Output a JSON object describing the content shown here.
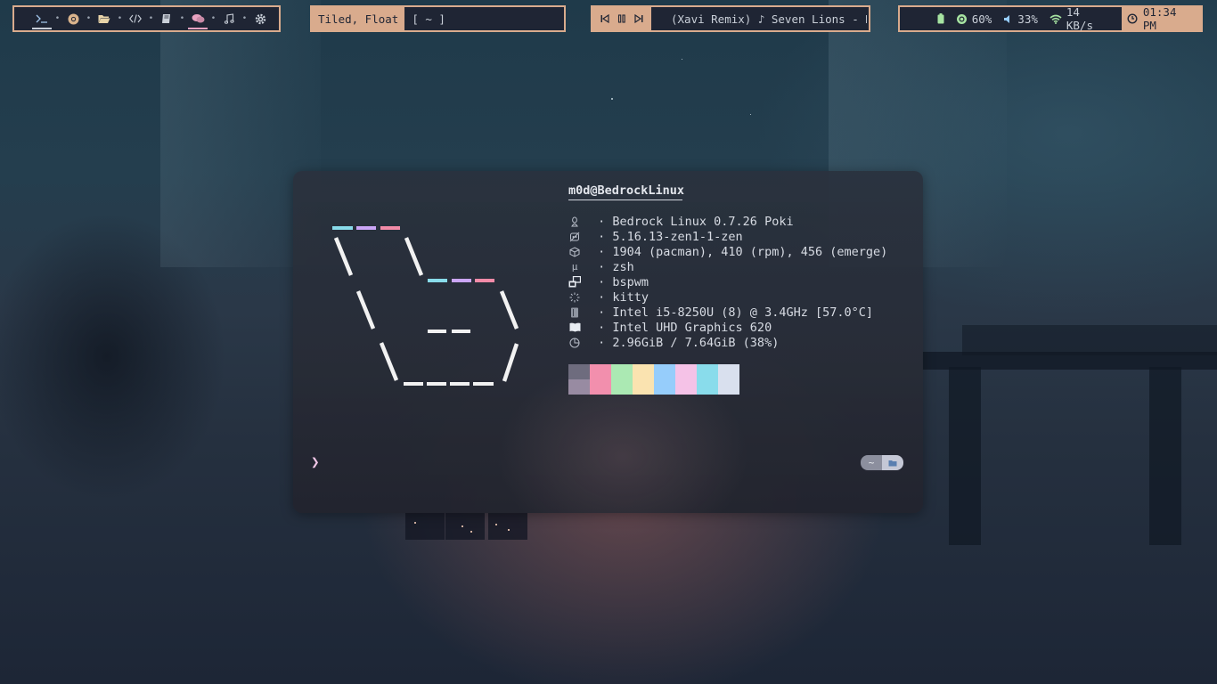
{
  "topbar": {
    "workspaces": [
      {
        "name": "terminal-icon",
        "active": true,
        "accent": "#c9cfd8"
      },
      {
        "name": "chrome-icon",
        "active": false
      },
      {
        "name": "folder-icon",
        "active": false
      },
      {
        "name": "code-icon",
        "active": false
      },
      {
        "name": "book-icon",
        "active": false
      },
      {
        "name": "chat-icon",
        "active": true,
        "accent": "#e8a2c0"
      },
      {
        "name": "music-icon",
        "active": false
      },
      {
        "name": "gear-icon",
        "active": false
      }
    ],
    "layout_label": "Tiled, Float",
    "window_title": "[ ~ ]",
    "media": {
      "track": "(Xavi Remix) ♪ Seven Lions - D",
      "controls": [
        "previous-icon",
        "pause-icon",
        "next-icon"
      ]
    },
    "status": {
      "battery_icon": "battery-icon",
      "brightness": "60%",
      "volume": "33%",
      "network_speed": "14 KB/s",
      "time": "01:34 PM"
    }
  },
  "terminal": {
    "user_host": "m0d@BedrockLinux",
    "separator": "────────────────",
    "info_rows": [
      {
        "icon": "linux-icon",
        "text": " · Bedrock Linux 0.7.26 Poki"
      },
      {
        "icon": "kernel-icon",
        "text": " · 5.16.13-zen1-1-zen"
      },
      {
        "icon": "package-icon",
        "text": " · 1904 (pacman), 410 (rpm), 456 (emerge)"
      },
      {
        "icon": "shell-icon",
        "text": " · zsh"
      },
      {
        "icon": "window-manager-icon",
        "text": " · bspwm"
      },
      {
        "icon": "terminal-app-icon",
        "text": " · kitty"
      },
      {
        "icon": "cpu-icon",
        "text": " · Intel i5-8250U (8) @ 3.4GHz [57.0°C]"
      },
      {
        "icon": "gpu-icon",
        "text": " · Intel UHD Graphics 620"
      },
      {
        "icon": "memory-icon",
        "text": " · 2.96GiB / 7.64GiB (38%)"
      }
    ],
    "palette": [
      [
        "#6e6c7e",
        "#988ba2"
      ],
      [
        "#f28fad",
        "#f28fad"
      ],
      [
        "#abe9b3",
        "#abe9b3"
      ],
      [
        "#fae3b0",
        "#fae3b0"
      ],
      [
        "#96cdfb",
        "#96cdfb"
      ],
      [
        "#f5c2e7",
        "#f5c2e7"
      ],
      [
        "#89dceb",
        "#89dceb"
      ],
      [
        "#d9e0ee",
        "#d9e0ee"
      ]
    ],
    "prompt_symbol": "❯",
    "cwd_badge": "~"
  }
}
